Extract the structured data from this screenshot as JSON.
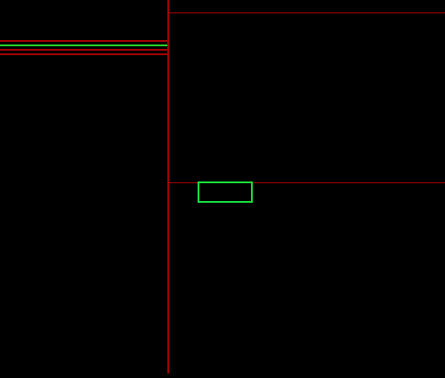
{
  "header": {
    "title": "",
    "subtitle": ""
  },
  "sidebar": {
    "topRows": [],
    "midRows": [],
    "infoRows": [],
    "bottomRows": []
  },
  "tabs": [],
  "chart": {
    "indicator_label": "",
    "highlight_label": ""
  },
  "footer": {
    "text": ""
  },
  "chart_data": {
    "type": "bar",
    "categories": [],
    "values": [],
    "ylim": [
      0,
      100
    ]
  }
}
